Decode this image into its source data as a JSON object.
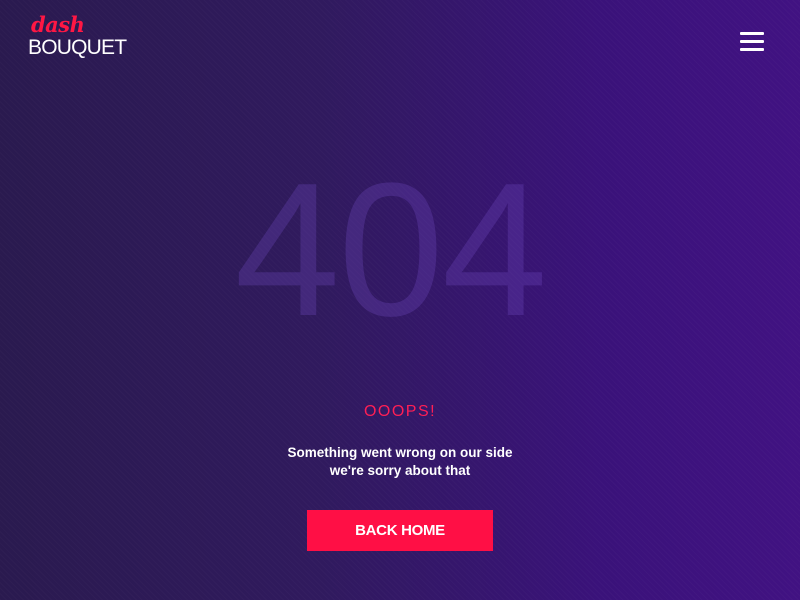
{
  "brand": {
    "script_text": "dash",
    "word_text": "BOUQUET",
    "accent_color": "#ff1744"
  },
  "header": {
    "menu_icon": "hamburger-menu-icon"
  },
  "error": {
    "code": "404",
    "headline": "OOOPS!",
    "message_line1": "Something went wrong on our side",
    "message_line2": "we're sorry about that"
  },
  "actions": {
    "back_home_label": "BACK HOME",
    "button_color": "#ff0f45"
  },
  "theme": {
    "background_start": "#2a1a4f",
    "background_end": "#411282"
  }
}
